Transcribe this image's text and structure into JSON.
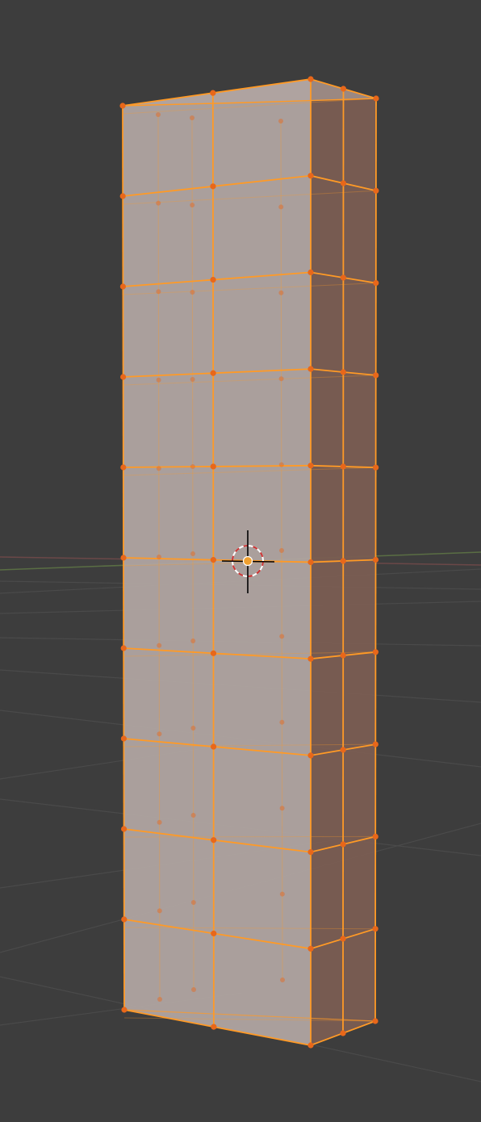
{
  "viewport": {
    "mode": "Edit Mode",
    "selection": "all",
    "background_color": "#3d3d3d",
    "grid_color": "#4a4a4a",
    "x_axis_color": "#6b4848",
    "y_axis_color": "#5a6e44"
  },
  "mesh": {
    "type": "subdivided-box",
    "horizontal_rows": 10,
    "front_vertical_cuts": 3,
    "side_vertical_cuts": 2,
    "front_face_color": "#b3a7a4",
    "side_face_color": "#7a5d52",
    "edge_color": "#ff9a26",
    "vertex_color": "#e8671a",
    "all_selected": true
  },
  "gizmo": {
    "name": "3d-cursor",
    "ring_colors": [
      "#ffffff",
      "#cc3333"
    ],
    "origin_color": "#f0a030"
  }
}
